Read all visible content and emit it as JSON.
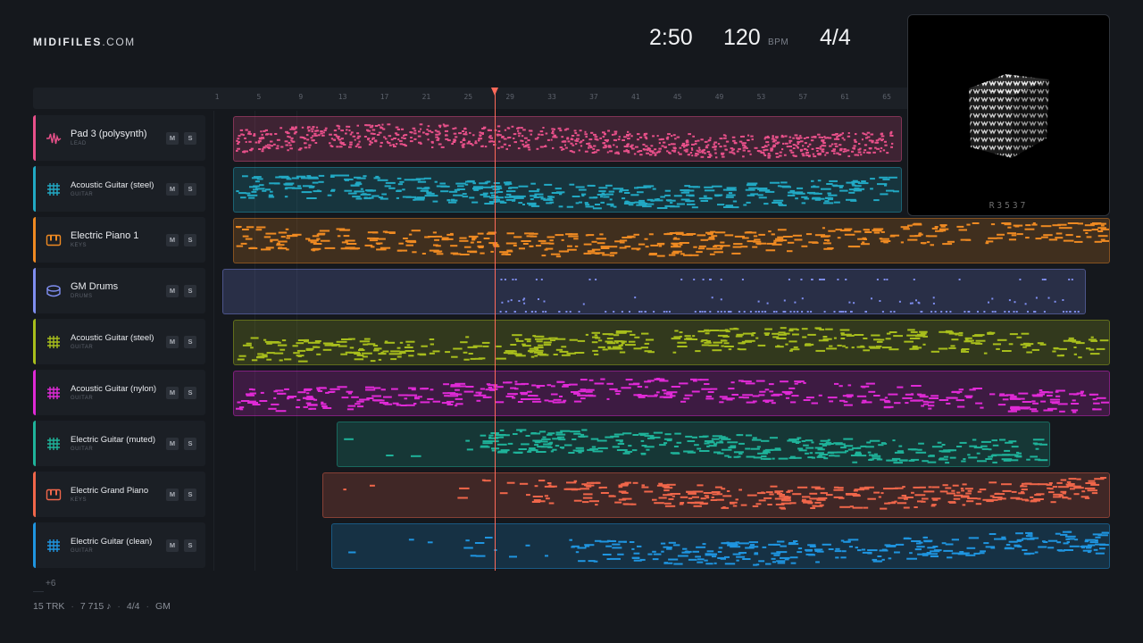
{
  "brand": {
    "name": "MIDIFILES",
    "suffix": ".COM"
  },
  "header": {
    "duration": "2:50",
    "tempo": "120",
    "tempo_unit": "BPM",
    "time_signature": "4/4"
  },
  "ruler": {
    "bars": [
      "1",
      "5",
      "9",
      "13",
      "17",
      "21",
      "25",
      "29",
      "33",
      "37",
      "41",
      "45",
      "49",
      "53",
      "57",
      "61",
      "65"
    ]
  },
  "playhead": {
    "bar": 27.5
  },
  "tracks": [
    {
      "name": "Pad 3 (polysynth)",
      "category": "LEAD",
      "icon": "waveform-icon",
      "color": "#e8508a",
      "mute": "M",
      "solo": "S"
    },
    {
      "name": "Acoustic Guitar (steel)",
      "category": "GUITAR",
      "icon": "guitar-icon",
      "color": "#22a9c4",
      "mute": "M",
      "solo": "S"
    },
    {
      "name": "Electric Piano 1",
      "category": "KEYS",
      "icon": "piano-icon",
      "color": "#ef8a22",
      "mute": "M",
      "solo": "S"
    },
    {
      "name": "GM Drums",
      "category": "DRUMS",
      "icon": "drum-icon",
      "color": "#7f8ef0",
      "mute": "M",
      "solo": "S"
    },
    {
      "name": "Acoustic Guitar (steel)",
      "category": "GUITAR",
      "icon": "guitar-icon",
      "color": "#a8be1c",
      "mute": "M",
      "solo": "S"
    },
    {
      "name": "Acoustic Guitar (nylon)",
      "category": "GUITAR",
      "icon": "guitar-icon",
      "color": "#e02ad6",
      "mute": "M",
      "solo": "S"
    },
    {
      "name": "Electric Guitar (muted)",
      "category": "GUITAR",
      "icon": "guitar-icon",
      "color": "#1fb39a",
      "mute": "M",
      "solo": "S"
    },
    {
      "name": "Electric Grand Piano",
      "category": "KEYS",
      "icon": "piano-icon",
      "color": "#f0664a",
      "mute": "M",
      "solo": "S"
    },
    {
      "name": "Electric Guitar (clean)",
      "category": "GUITAR",
      "icon": "guitar-icon",
      "color": "#1f95e0",
      "mute": "M",
      "solo": "S"
    }
  ],
  "more_tracks": "+6",
  "footer": {
    "tracks": "15 TRK",
    "notes": "7 715 ♪",
    "time_sig": "4/4",
    "standard": "GM"
  },
  "artwork": {
    "code": "R3537"
  }
}
